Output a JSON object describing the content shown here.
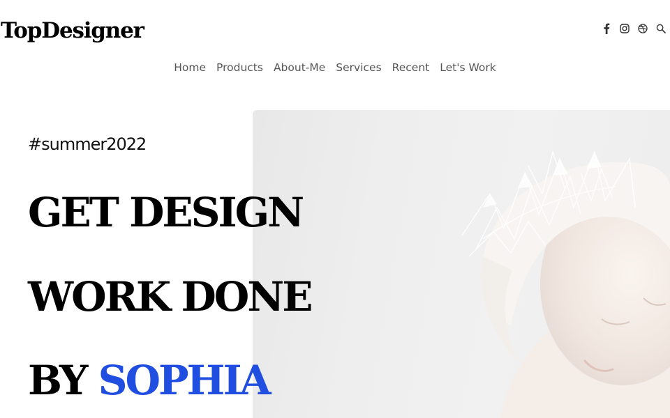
{
  "header": {
    "logo": "TopDesigner",
    "social_icons": [
      "facebook-icon",
      "instagram-icon",
      "dribbble-icon",
      "search-icon"
    ]
  },
  "nav": {
    "items": [
      "Home",
      "Products",
      "About-Me",
      "Services",
      "Recent",
      "Let's Work"
    ]
  },
  "hero": {
    "hashtag": "#summer2022",
    "line1": "GET DESIGN",
    "line2": "WORK DONE",
    "line3_prefix": "BY",
    "line3_accent": "SOPHIA"
  },
  "colors": {
    "accent": "#1f4ee0",
    "text": "#000000",
    "nav_text": "#555555",
    "background": "#ffffff"
  }
}
